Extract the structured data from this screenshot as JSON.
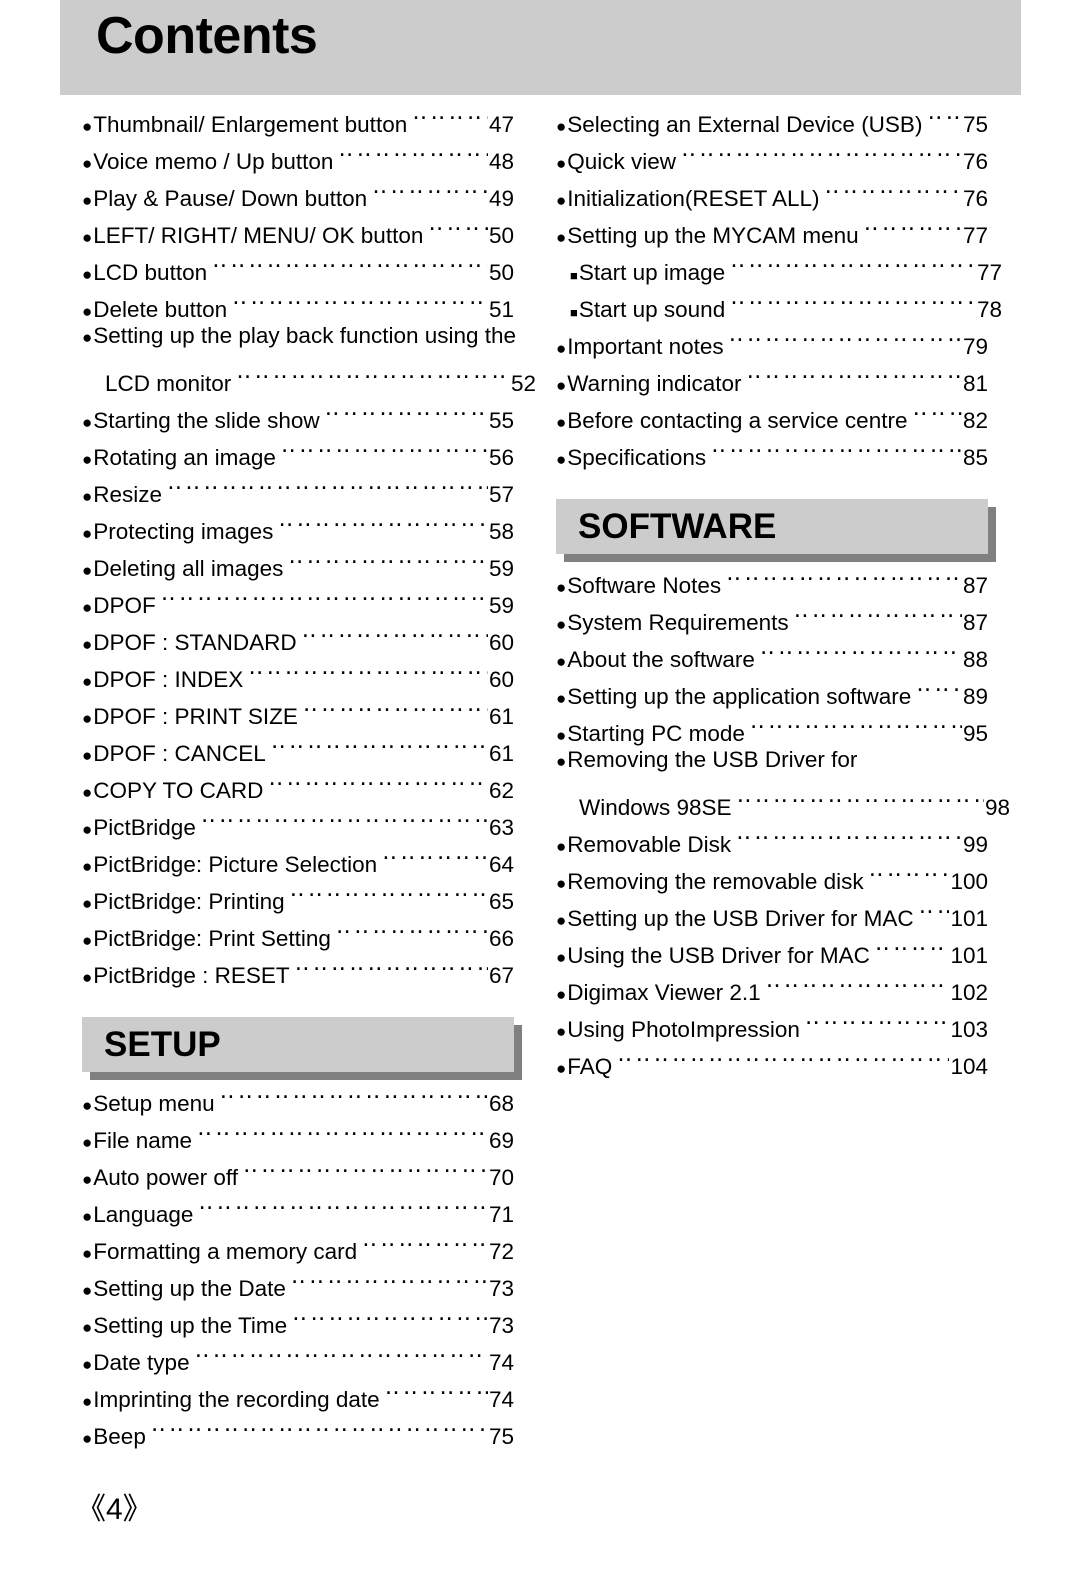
{
  "page": {
    "title": "Contents",
    "footer_page_number": "《4》",
    "header_bg": "#cccccc",
    "band_bg": "#cccccc",
    "band_shadow": "#808080",
    "text_color": "#000000"
  },
  "bullets": {
    "disc": "●",
    "square": "■",
    "leader_dots": "‥‥‥‥‥‥‥‥‥‥‥‥‥‥‥‥‥‥‥‥‥‥‥‥‥‥‥‥‥‥‥‥‥‥‥‥‥‥‥‥‥‥"
  },
  "left_column": {
    "entries": [
      {
        "bullet": "disc",
        "label": "Thumbnail/ Enlargement button",
        "page": "47"
      },
      {
        "bullet": "disc",
        "label": "Voice memo / Up button",
        "page": "48"
      },
      {
        "bullet": "disc",
        "label": "Play & Pause/ Down button",
        "page": "49"
      },
      {
        "bullet": "disc",
        "label": "LEFT/ RIGHT/ MENU/ OK button",
        "page": "50"
      },
      {
        "bullet": "disc",
        "label": "LCD button",
        "page": "50"
      },
      {
        "bullet": "disc",
        "label": "Delete button",
        "page": "51"
      },
      {
        "bullet": "disc",
        "label": "Setting up the play back function using the",
        "page": "",
        "no_leader": true
      },
      {
        "bullet": "none",
        "label": "LCD monitor",
        "page": "52",
        "continuation": true
      },
      {
        "bullet": "disc",
        "label": "Starting the slide show",
        "page": "55"
      },
      {
        "bullet": "disc",
        "label": "Rotating an image",
        "page": "56"
      },
      {
        "bullet": "disc",
        "label": "Resize",
        "page": "57"
      },
      {
        "bullet": "disc",
        "label": "Protecting images",
        "page": "58"
      },
      {
        "bullet": "disc",
        "label": "Deleting all images",
        "page": "59"
      },
      {
        "bullet": "disc",
        "label": "DPOF",
        "page": "59"
      },
      {
        "bullet": "disc",
        "label": "DPOF : STANDARD",
        "page": "60"
      },
      {
        "bullet": "disc",
        "label": "DPOF : INDEX",
        "page": "60"
      },
      {
        "bullet": "disc",
        "label": "DPOF : PRINT SIZE",
        "page": "61"
      },
      {
        "bullet": "disc",
        "label": "DPOF : CANCEL",
        "page": "61"
      },
      {
        "bullet": "disc",
        "label": "COPY TO CARD",
        "page": "62"
      },
      {
        "bullet": "disc",
        "label": "PictBridge",
        "page": "63"
      },
      {
        "bullet": "disc",
        "label": "PictBridge: Picture Selection",
        "page": "64"
      },
      {
        "bullet": "disc",
        "label": "PictBridge: Printing",
        "page": "65"
      },
      {
        "bullet": "disc",
        "label": "PictBridge: Print Setting",
        "page": "66"
      },
      {
        "bullet": "disc",
        "label": "PictBridge : RESET",
        "page": "67"
      }
    ],
    "section": {
      "band_label": "SETUP",
      "entries": [
        {
          "bullet": "disc",
          "label": "Setup menu",
          "page": "68"
        },
        {
          "bullet": "disc",
          "label": "File name",
          "page": "69"
        },
        {
          "bullet": "disc",
          "label": "Auto power off",
          "page": "70"
        },
        {
          "bullet": "disc",
          "label": "Language",
          "page": "71"
        },
        {
          "bullet": "disc",
          "label": "Formatting a memory card",
          "page": "72"
        },
        {
          "bullet": "disc",
          "label": "Setting up the Date",
          "page": "73"
        },
        {
          "bullet": "disc",
          "label": "Setting up the Time",
          "page": "73"
        },
        {
          "bullet": "disc",
          "label": "Date type",
          "page": "74"
        },
        {
          "bullet": "disc",
          "label": "Imprinting the recording date",
          "page": "74"
        },
        {
          "bullet": "disc",
          "label": "Beep",
          "page": "75"
        }
      ]
    }
  },
  "right_column": {
    "entries": [
      {
        "bullet": "disc",
        "label": "Selecting an External Device (USB)",
        "page": "75"
      },
      {
        "bullet": "disc",
        "label": "Quick view",
        "page": "76"
      },
      {
        "bullet": "disc",
        "label": "Initialization(RESET ALL)",
        "page": "76"
      },
      {
        "bullet": "disc",
        "label": "Setting up the MYCAM menu",
        "page": "77"
      },
      {
        "bullet": "square",
        "label": "Start up image",
        "page": "77",
        "sub": true
      },
      {
        "bullet": "square",
        "label": "Start up sound",
        "page": "78",
        "sub": true
      },
      {
        "bullet": "disc",
        "label": "Important notes",
        "page": "79"
      },
      {
        "bullet": "disc",
        "label": "Warning indicator",
        "page": "81"
      },
      {
        "bullet": "disc",
        "label": "Before contacting a service centre",
        "page": "82"
      },
      {
        "bullet": "disc",
        "label": "Specifications",
        "page": "85"
      }
    ],
    "section": {
      "band_label": "SOFTWARE",
      "entries": [
        {
          "bullet": "disc",
          "label": "Software Notes",
          "page": "87"
        },
        {
          "bullet": "disc",
          "label": "System Requirements",
          "page": "87"
        },
        {
          "bullet": "disc",
          "label": "About the software",
          "page": "88"
        },
        {
          "bullet": "disc",
          "label": "Setting up the application software",
          "page": "89"
        },
        {
          "bullet": "disc",
          "label": "Starting PC mode",
          "page": "95"
        },
        {
          "bullet": "disc",
          "label": "Removing the USB Driver for",
          "page": "",
          "no_leader": true
        },
        {
          "bullet": "none",
          "label": "Windows 98SE",
          "page": "98",
          "continuation": true
        },
        {
          "bullet": "disc",
          "label": "Removable Disk",
          "page": "99"
        },
        {
          "bullet": "disc",
          "label": "Removing the removable disk",
          "page": "100"
        },
        {
          "bullet": "disc",
          "label": "Setting up the USB Driver for MAC",
          "page": "101"
        },
        {
          "bullet": "disc",
          "label": "Using the USB Driver for MAC",
          "page": "101"
        },
        {
          "bullet": "disc",
          "label": "Digimax Viewer 2.1",
          "page": "102"
        },
        {
          "bullet": "disc",
          "label": "Using PhotoImpression",
          "page": "103"
        },
        {
          "bullet": "disc",
          "label": "FAQ",
          "page": "104"
        }
      ]
    }
  }
}
